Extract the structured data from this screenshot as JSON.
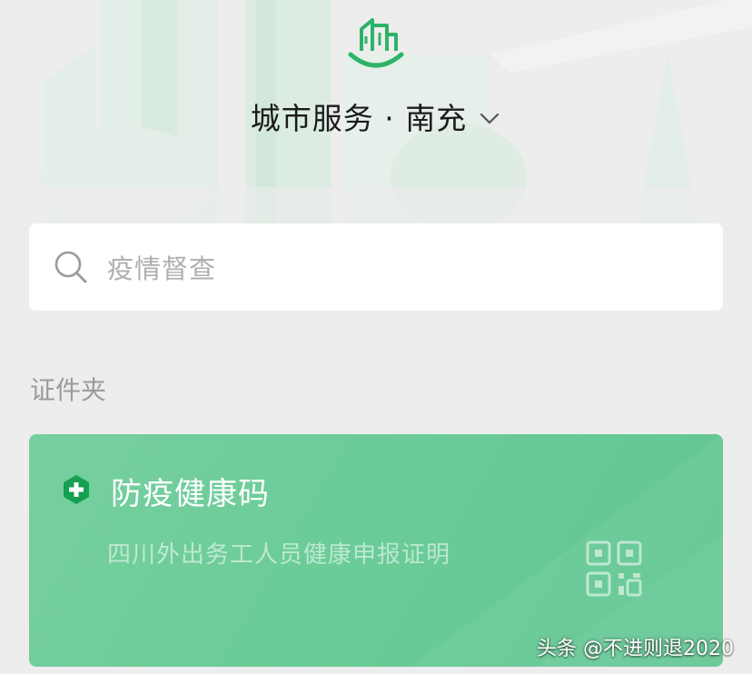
{
  "header": {
    "logo_icon": "city-building-smile-icon",
    "city_title": "城市服务 · 南充",
    "dropdown_icon": "chevron-down-icon"
  },
  "search": {
    "icon": "search-icon",
    "placeholder_text": "疫情督查"
  },
  "section": {
    "label": "证件夹"
  },
  "card": {
    "badge_icon": "shield-plus-icon",
    "title": "防疫健康码",
    "subtitle": "四川外出务工人员健康申报证明",
    "qr_icon": "qr-code-icon"
  },
  "watermark": {
    "text": "头条 @不进则退2020"
  },
  "colors": {
    "background": "#ededed",
    "brand_green": "#2db368",
    "card_green": "#6bcc98",
    "search_bg": "#ffffff"
  }
}
